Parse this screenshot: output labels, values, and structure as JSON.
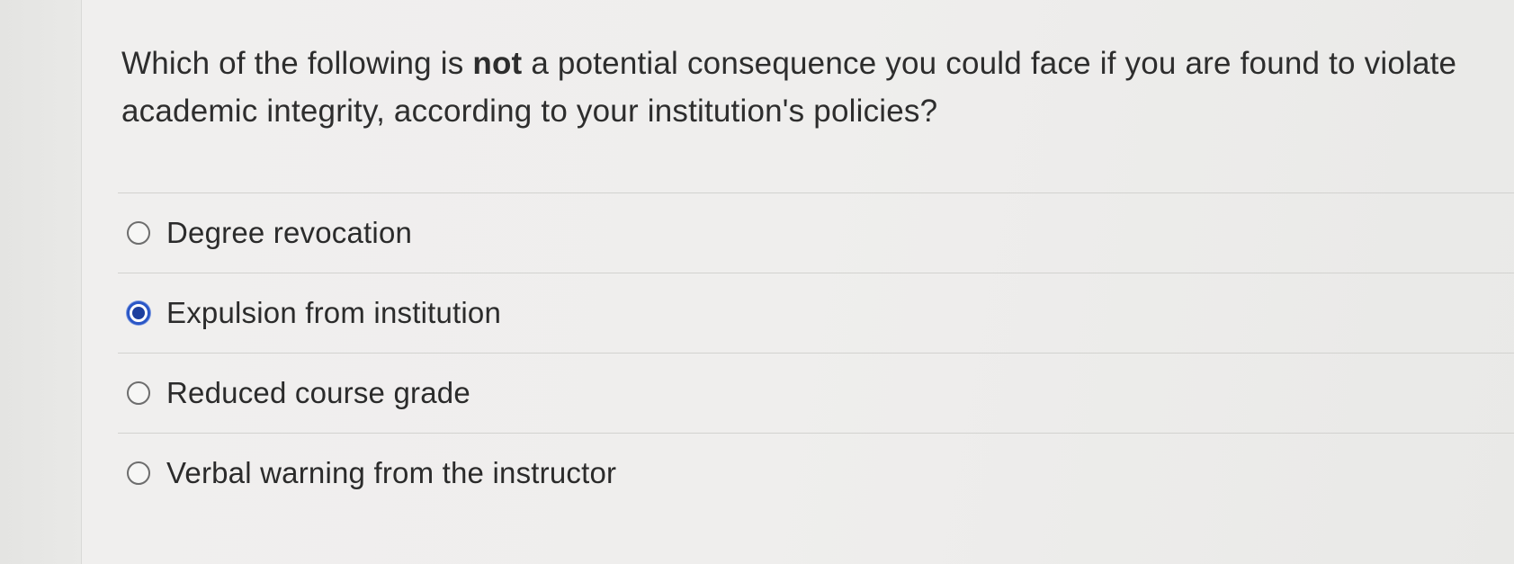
{
  "quiz": {
    "question": {
      "text_before": "Which of the following is ",
      "emphasis": "not",
      "text_after": " a potential consequence you could face if you are found to violate academic integrity, according to your institution's policies?"
    },
    "options": [
      {
        "label": "Degree revocation",
        "selected": false
      },
      {
        "label": "Expulsion from institution",
        "selected": true
      },
      {
        "label": "Reduced course grade",
        "selected": false
      },
      {
        "label": "Verbal warning from the instructor",
        "selected": false
      }
    ],
    "colors": {
      "selected_radio": "#2a56c6",
      "text": "#2b2b2b"
    }
  }
}
